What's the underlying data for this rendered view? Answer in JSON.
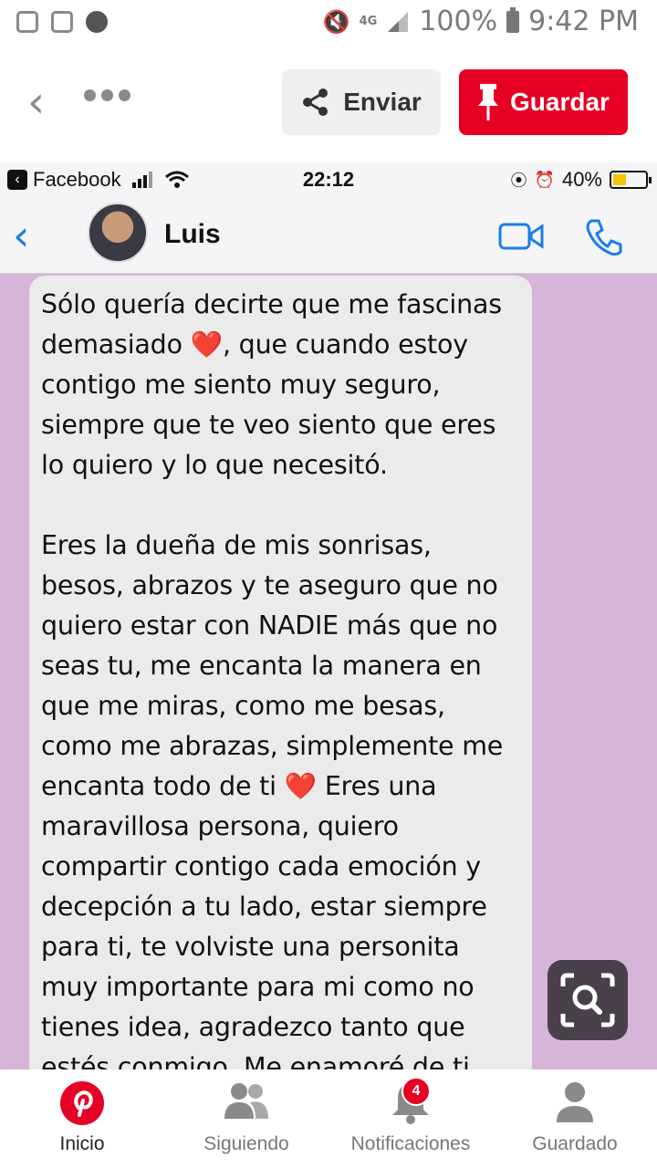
{
  "status_bar": {
    "battery": "100%",
    "time": "9:42 PM",
    "network": "4G"
  },
  "header": {
    "send_label": "Enviar",
    "save_label": "Guardar"
  },
  "pin_image": {
    "ios_status": {
      "app": "Facebook",
      "time": "22:12",
      "battery": "40%"
    },
    "chat": {
      "contact": "Luis"
    },
    "message": {
      "p1": [
        "Sólo quería decirte que me fascinas",
        "demasiado ❤️, que cuando estoy",
        "contigo me siento muy seguro,",
        "siempre que te veo siento que eres",
        "lo quiero y lo que necesitó."
      ],
      "p2": [
        "Eres la dueña de mis sonrisas,",
        "besos, abrazos y te aseguro que no",
        "quiero estar con NADIE más que no",
        "seas tu, me encanta la manera en",
        "que me miras, como me besas,",
        "como me abrazas, simplemente me",
        "encanta todo de ti ❤️ Eres una",
        "maravillosa persona, quiero",
        "compartir contigo cada emoción y",
        "decepción a tu lado, estar siempre",
        "para ti, te volviste una personita",
        "muy importante para mi como no",
        "tienes idea, agradezco tanto que",
        "estés conmigo. Me enamoré de ti"
      ]
    }
  },
  "tabs": [
    {
      "label": "Inicio",
      "icon": "pinterest-logo-icon",
      "active": true
    },
    {
      "label": "Siguiendo",
      "icon": "people-icon"
    },
    {
      "label": "Notificaciones",
      "icon": "bell-icon",
      "badge": "4"
    },
    {
      "label": "Guardado",
      "icon": "person-icon"
    }
  ],
  "colors": {
    "accent": "#e60023",
    "chat_bg": "#d7b5d8",
    "bubble": "#ebebeb",
    "ios_blue": "#1a7de8"
  }
}
